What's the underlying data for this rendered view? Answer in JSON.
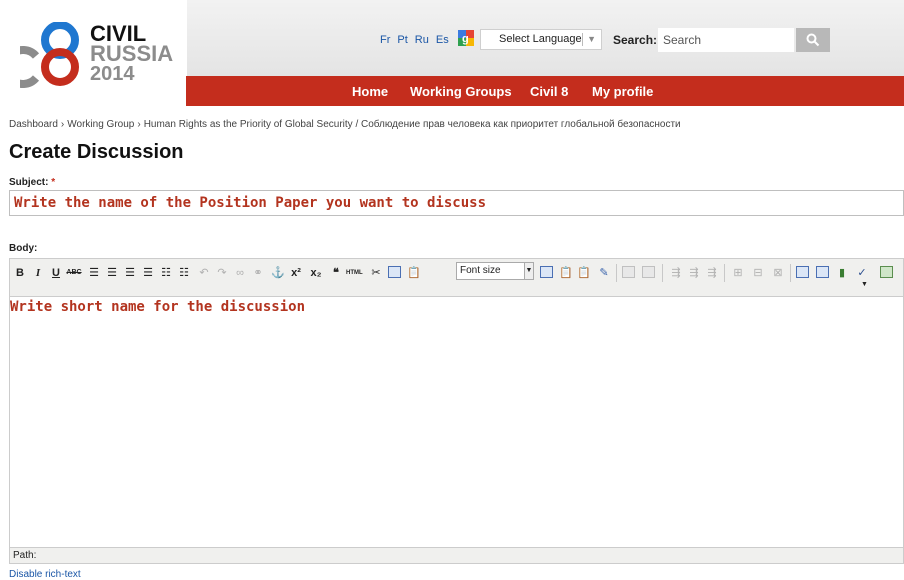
{
  "logo": {
    "line1": "CIVIL",
    "line2": "RUSSIA",
    "line3": "2014",
    "brand_red": "#c42d1d",
    "brand_blue": "#1f77d0",
    "brand_grey": "#8c8c8c"
  },
  "header": {
    "languages": [
      "Fr",
      "Pt",
      "Ru",
      "Es"
    ],
    "select_language": "Select Language",
    "search_label": "Search:",
    "search_placeholder": "Search"
  },
  "nav": {
    "items": [
      "Home",
      "Working Groups",
      "Civil 8",
      "My profile"
    ]
  },
  "breadcrumb": {
    "items": [
      "Dashboard",
      "Working Group",
      "Human Rights as the Priority of Global Security / Соблюдение прав человека как приоритет глобальной безопасности"
    ],
    "separator": "›"
  },
  "page": {
    "title": "Create Discussion",
    "subject_label": "Subject:",
    "required_mark": "*",
    "subject_value": "Write the name of the Position Paper you want to discuss",
    "body_label": "Body:",
    "body_value": "Write short name for the discussion",
    "path_label": "Path:",
    "disable_rich_text": "Disable rich-text"
  },
  "toolbar": {
    "bold": "B",
    "italic": "I",
    "underline": "U",
    "strike": "ABC",
    "superscript": "x²",
    "subscript": "x₂",
    "quote": "❝",
    "html": "HTML",
    "font_size": "Font size"
  },
  "colors": {
    "accent_red": "#c42d1d",
    "link_blue": "#1a56a6",
    "text_red": "#b3341f"
  }
}
